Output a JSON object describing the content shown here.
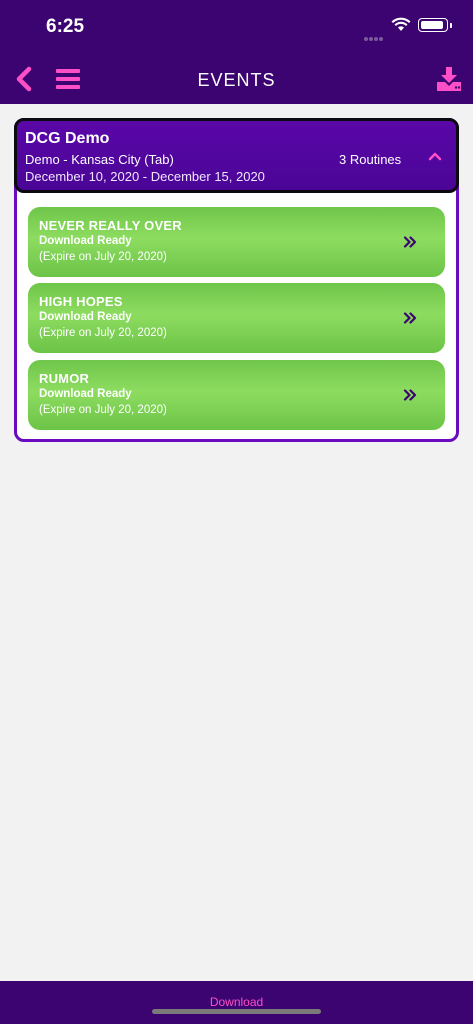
{
  "status_bar": {
    "time": "6:25"
  },
  "nav": {
    "title": "EVENTS",
    "back_icon": "chevron-left-icon",
    "menu_icon": "hamburger-menu-icon",
    "download_icon": "download-tray-icon",
    "icon_color": "#ff4fc8"
  },
  "event": {
    "title": "DCG Demo",
    "location": "Demo - Kansas City (Tab)",
    "routines_count": "3 Routines",
    "dates": "December 10, 2020 - December 15, 2020",
    "collapse_icon": "chevron-up-icon",
    "routines": [
      {
        "name": "NEVER REALLY OVER",
        "status": "Download Ready",
        "expire": "(Expire on July 20, 2020)"
      },
      {
        "name": "HIGH HOPES",
        "status": "Download Ready",
        "expire": "(Expire on July 20, 2020)"
      },
      {
        "name": "RUMOR",
        "status": "Download Ready",
        "expire": "(Expire on July 20, 2020)"
      }
    ]
  },
  "footer": {
    "tab_label": "Download"
  },
  "colors": {
    "header_bg": "#3c0470",
    "event_header_bg": "#4f069c",
    "routine_bg": "#7ccf52",
    "accent": "#ff4fc8"
  }
}
